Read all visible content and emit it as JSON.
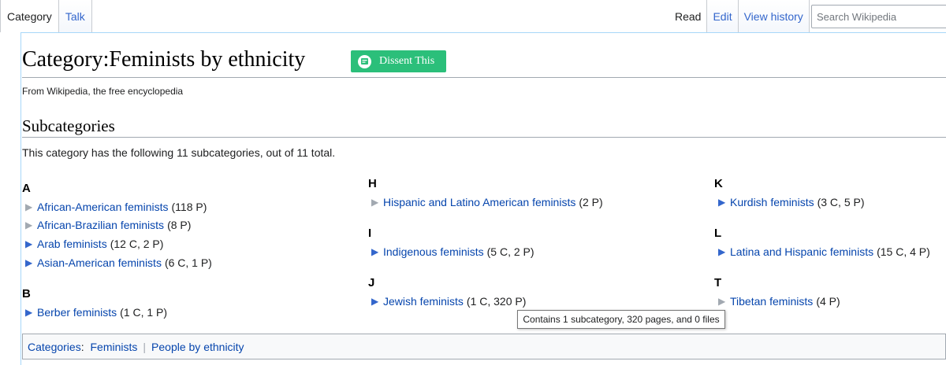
{
  "tabs": {
    "left": [
      {
        "label": "Category",
        "selected": true
      },
      {
        "label": "Talk",
        "selected": false
      }
    ],
    "right": [
      {
        "label": "Read",
        "selected": true
      },
      {
        "label": "Edit",
        "selected": false
      },
      {
        "label": "View history",
        "selected": false
      }
    ],
    "search_placeholder": "Search Wikipedia"
  },
  "page": {
    "title": "Category:Feminists by ethnicity",
    "dissent_button": "Dissent This",
    "tagline": "From Wikipedia, the free encyclopedia"
  },
  "subcategories": {
    "heading": "Subcategories",
    "description": "This category has the following 11 subcategories, out of 11 total.",
    "columns": [
      {
        "groups": [
          {
            "letter": "A",
            "items": [
              {
                "name": "African-American feminists",
                "count": "(118 P)",
                "expandable": false
              },
              {
                "name": "African-Brazilian feminists",
                "count": "(8 P)",
                "expandable": false
              },
              {
                "name": "Arab feminists",
                "count": "(12 C, 2 P)",
                "expandable": true
              },
              {
                "name": "Asian-American feminists",
                "count": "(6 C, 1 P)",
                "expandable": true
              }
            ]
          },
          {
            "letter": "B",
            "items": [
              {
                "name": "Berber feminists",
                "count": "(1 C, 1 P)",
                "expandable": true
              }
            ]
          }
        ]
      },
      {
        "groups": [
          {
            "letter": "H",
            "items": [
              {
                "name": "Hispanic and Latino American feminists",
                "count": "(2 P)",
                "expandable": false
              }
            ]
          },
          {
            "letter": "I",
            "items": [
              {
                "name": "Indigenous feminists",
                "count": "(5 C, 2 P)",
                "expandable": true
              }
            ]
          },
          {
            "letter": "J",
            "items": [
              {
                "name": "Jewish feminists",
                "count": "(1 C, 320 P)",
                "expandable": true
              }
            ]
          }
        ]
      },
      {
        "groups": [
          {
            "letter": "K",
            "items": [
              {
                "name": "Kurdish feminists",
                "count": "(3 C, 5 P)",
                "expandable": true
              }
            ]
          },
          {
            "letter": "L",
            "items": [
              {
                "name": "Latina and Hispanic feminists",
                "count": "(15 C, 4 P)",
                "expandable": true
              }
            ]
          },
          {
            "letter": "T",
            "items": [
              {
                "name": "Tibetan feminists",
                "count": "(4 P)",
                "expandable": false
              }
            ]
          }
        ]
      }
    ]
  },
  "tooltip": "Contains 1 subcategory, 320 pages, and 0 files",
  "categories": {
    "label": "Categories",
    "links": [
      "Feminists",
      "People by ethnicity"
    ]
  },
  "icons": {
    "expand": "triangle-right-icon",
    "dissent": "comment-icon"
  },
  "colors": {
    "link": "#0645ad",
    "dissent_green": "#2bbf7a",
    "bullet_expand": "#3366cc",
    "bullet_empty": "#a2a9b1"
  }
}
